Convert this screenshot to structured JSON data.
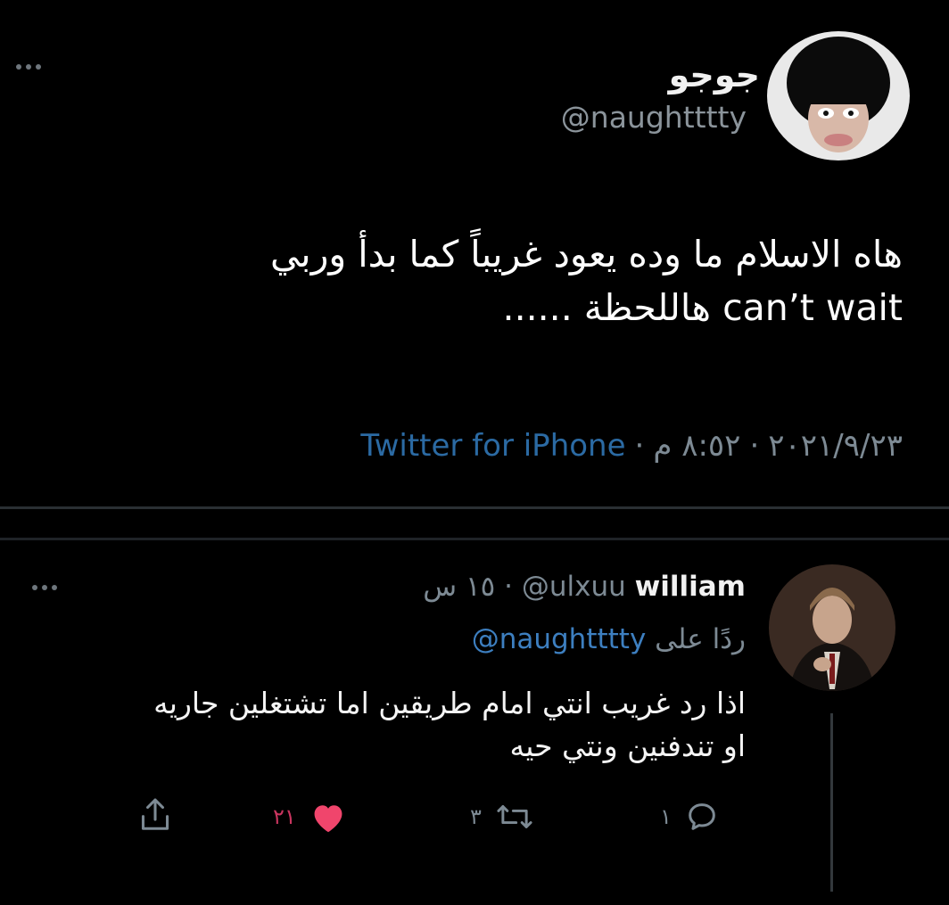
{
  "main_tweet": {
    "author_name": "جوجو",
    "author_handle": "@naughtttty",
    "text_lines": [
      "هاه الاسلام ما وده يعود غريباً كما بدأ وربي",
      "can’t wait هاللحظة ......"
    ],
    "date": "٢٠٢١/٩/٢٣",
    "time": "٨:٥٢ م",
    "source": "Twitter for iPhone",
    "separator": "·",
    "more_icon": "more-dots-icon"
  },
  "reply": {
    "author_name": "william",
    "author_handle": "@ulxuu",
    "age": "١٥ س",
    "separator": "·",
    "replying_to_label": "ردًا على",
    "replying_to_handle": "@naughtttty",
    "text_lines": [
      "اذا رد غريب انتي امام طريقين اما تشتغلين جاريه",
      "او تندفنين ونتي حيه"
    ],
    "actions": {
      "reply_count": "١",
      "retweet_count": "٣",
      "like_count": "٢١",
      "share_icon": "share-icon"
    }
  },
  "colors": {
    "background": "#000000",
    "text": "#ffffff",
    "secondary": "#7d8a94",
    "link": "#2b6aa3",
    "like": "#f0456c"
  }
}
